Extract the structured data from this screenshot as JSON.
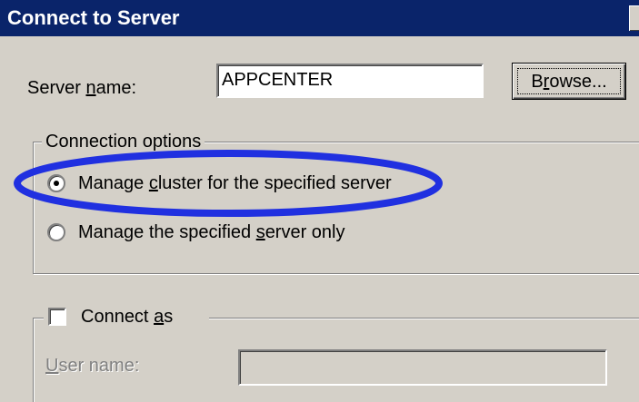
{
  "window": {
    "title": "Connect to Server"
  },
  "server": {
    "label_pre": "Server ",
    "label_key": "n",
    "label_post": "ame:",
    "value": "APPCENTER"
  },
  "browse": {
    "label_pre": "B",
    "label_key": "r",
    "label_post": "owse..."
  },
  "connection_options": {
    "legend": "Connection options",
    "options": [
      {
        "label_pre": "Manage ",
        "label_key": "c",
        "label_post": "luster for the specified server",
        "selected": true
      },
      {
        "label_pre": "Manage the specified ",
        "label_key": "s",
        "label_post": "erver only",
        "selected": false
      }
    ]
  },
  "connect_as": {
    "label_pre": "Connect ",
    "label_key": "a",
    "label_post": "s",
    "checked": false
  },
  "user": {
    "label_pre": "",
    "label_key": "U",
    "label_post": "ser name:",
    "value": ""
  },
  "colors": {
    "title_bar": "#0a246a",
    "dialog_face": "#d4d0c8",
    "highlight_ellipse": "#2030e0",
    "disabled_text": "#808080"
  }
}
